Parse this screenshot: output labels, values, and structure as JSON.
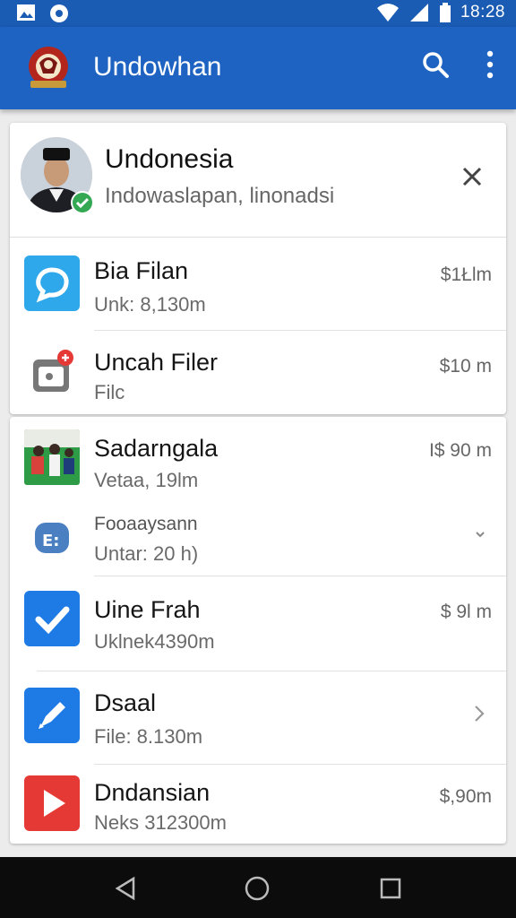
{
  "status": {
    "time": "18:28"
  },
  "app": {
    "title": "Undowhan"
  },
  "profile": {
    "name": "Undonesia",
    "subtitle": "Indowaslapan, linonadsi"
  },
  "rows": [
    {
      "title": "Bia Filan",
      "sub": "Unk: 8,130m",
      "price": "$1Łlm"
    },
    {
      "title": "Uncah Filer",
      "sub": "Filc",
      "price": "$10 m"
    },
    {
      "title": "Sadarngala",
      "sub": "Vetaa, 19lm",
      "price": "I$ 90 m"
    },
    {
      "title": "Fooaaysann",
      "sub": "Untar: 20 h)",
      "price": ""
    },
    {
      "title": "Uine Frah",
      "sub": "Uklnek4390m",
      "price": "$ 9l m"
    },
    {
      "title": "Dsaal",
      "sub": "File: 8.130m",
      "price": ""
    },
    {
      "title": "Dndansian",
      "sub": "Neks 312300m",
      "price": "$,90m"
    }
  ],
  "colors": {
    "primary": "#1e63c2",
    "status": "#1a5bb3",
    "accent_blue": "#2a7de1",
    "red": "#e53935",
    "green": "#34a853"
  },
  "icons": [
    "search-icon",
    "more-vert-icon",
    "close-icon",
    "chat-bubble-icon",
    "camera-icon",
    "photo-thumbnail",
    "share-icon",
    "checkmark-icon",
    "pen-icon",
    "play-icon"
  ]
}
